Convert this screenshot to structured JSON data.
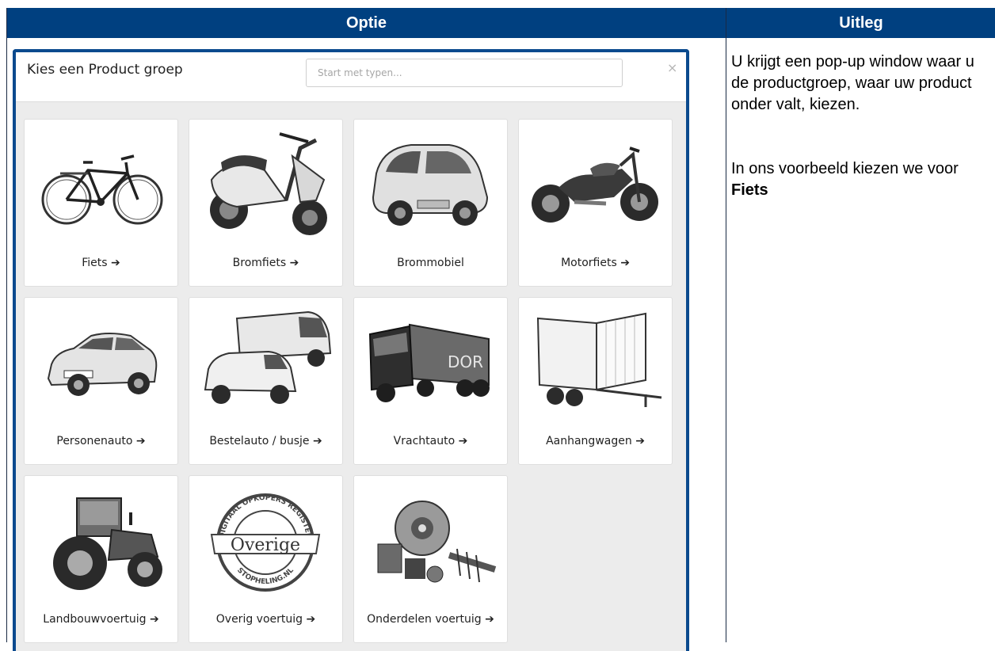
{
  "table": {
    "header_optie": "Optie",
    "header_uitleg": "Uitleg"
  },
  "modal": {
    "title": "Kies een Product groep",
    "search_placeholder": "Start met typen...",
    "close_label": "×",
    "cards": [
      {
        "label": "Fiets",
        "arrow": "➔",
        "icon": "bicycle-icon"
      },
      {
        "label": "Bromfiets",
        "arrow": "➔",
        "icon": "scooter-icon"
      },
      {
        "label": "Brommobiel",
        "arrow": "",
        "icon": "microcar-icon"
      },
      {
        "label": "Motorfiets",
        "arrow": "➔",
        "icon": "motorcycle-icon"
      },
      {
        "label": "Personenauto",
        "arrow": "➔",
        "icon": "car-icon"
      },
      {
        "label": "Bestelauto / busje",
        "arrow": "➔",
        "icon": "van-icon"
      },
      {
        "label": "Vrachtauto",
        "arrow": "➔",
        "icon": "truck-icon"
      },
      {
        "label": "Aanhangwagen",
        "arrow": "➔",
        "icon": "trailer-icon"
      },
      {
        "label": "Landbouwvoertuig",
        "arrow": "➔",
        "icon": "tractor-icon"
      },
      {
        "label": "Overig voertuig",
        "arrow": "➔",
        "icon": "stamp-icon"
      },
      {
        "label": "Onderdelen voertuig",
        "arrow": "➔",
        "icon": "parts-icon"
      }
    ],
    "stamp_text": {
      "top": "DIGITAAL OPKOPERS REGISTER",
      "center": "Overige",
      "bottom": "STOPHELING.NL"
    },
    "truck_text": "DOR"
  },
  "explanation": {
    "paragraph1": "U krijgt een pop-up window waar u de productgroep, waar uw product onder valt, kiezen.",
    "paragraph2_prefix": "In ons voorbeeld kiezen we voor ",
    "paragraph2_bold": "Fiets"
  },
  "colors": {
    "header_bg": "#004080",
    "modal_border": "#0b4a8e",
    "modal_bg": "#ececec"
  }
}
